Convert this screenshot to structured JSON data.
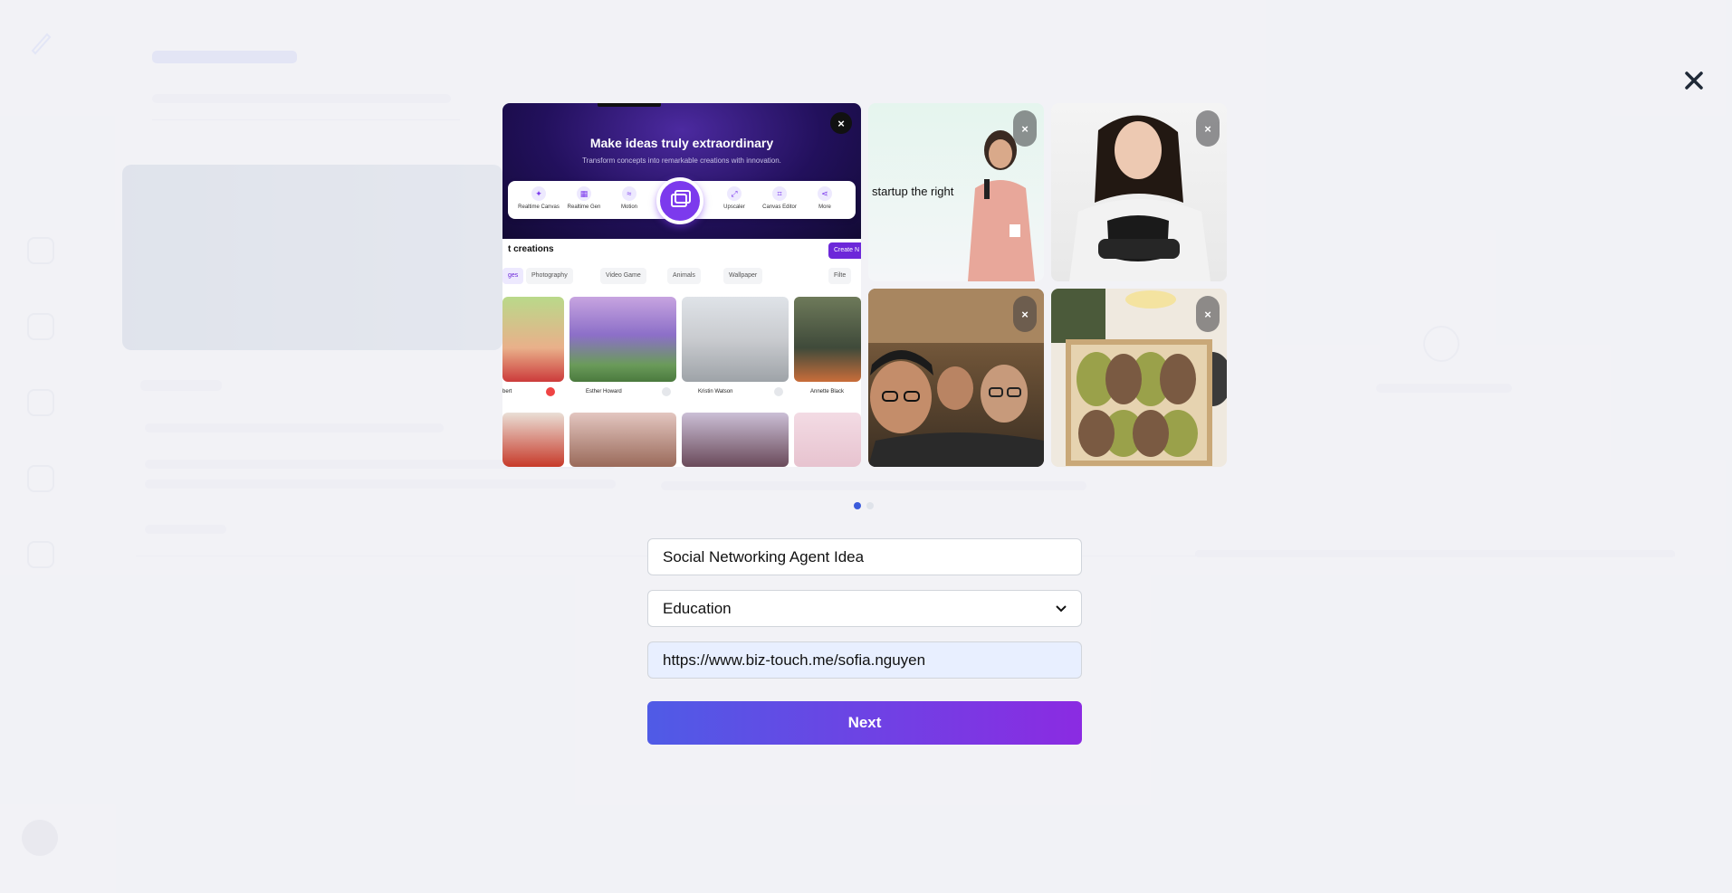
{
  "modal": {
    "close_icon": "close-icon",
    "gallery": {
      "preview": {
        "hero_title": "Make ideas truly extraordinary",
        "hero_subtitle": "Transform concepts into remarkable creations with innovation.",
        "tools": [
          "Realtime Canvas",
          "Realtime Gen",
          "Motion",
          "Upscaler",
          "Canvas Editor",
          "More"
        ],
        "section_title": "t creations",
        "create_button": "Create N",
        "chips": [
          "ges",
          "Photography",
          "Video Game",
          "Animals",
          "Wallpaper",
          "Filte"
        ],
        "authors": [
          "bert",
          "Esther Howard",
          "Kristin Watson",
          "Annette Black"
        ]
      },
      "speaker_caption": "startup the right",
      "remove_label": "×"
    },
    "pager": {
      "count": 2,
      "active": 0
    },
    "form": {
      "name_value": "Social Networking Agent Idea",
      "category_value": "Education",
      "url_value": "https://www.biz-touch.me/sofia.nguyen",
      "next_label": "Next"
    }
  },
  "colors": {
    "accent_start": "#4f5be6",
    "accent_end": "#8b2be2",
    "pager_active": "#3b5bdb"
  }
}
